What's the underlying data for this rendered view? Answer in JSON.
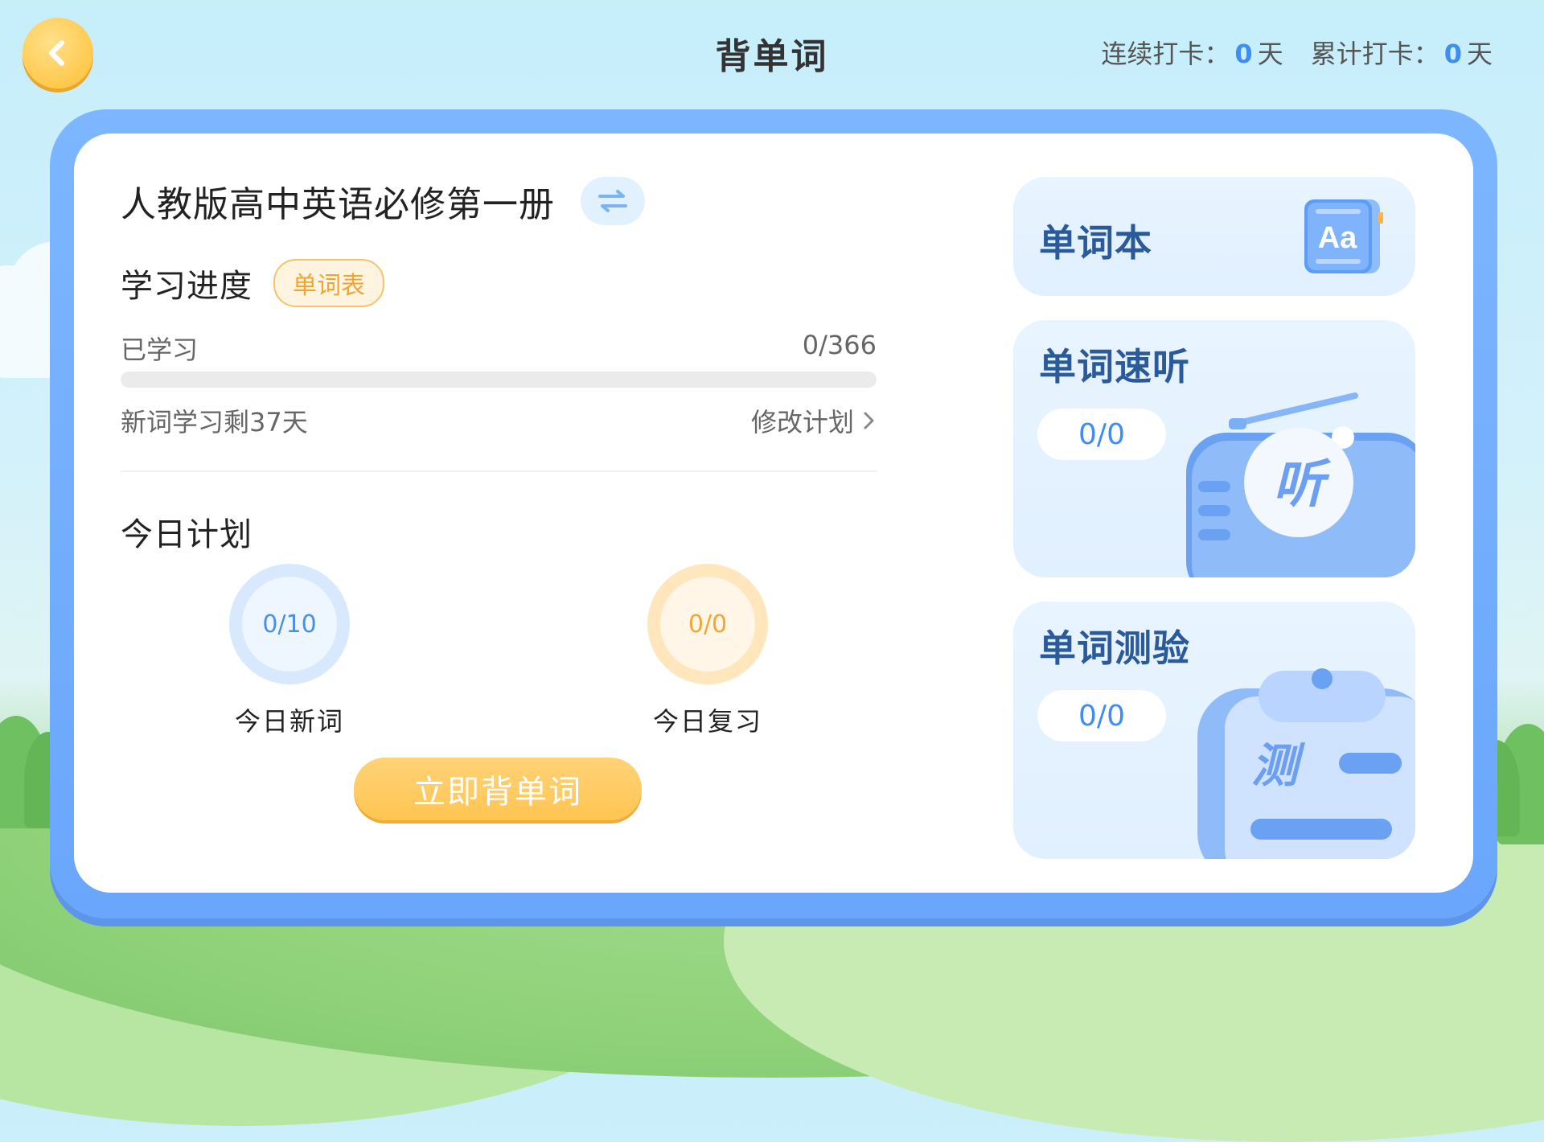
{
  "header": {
    "title": "背单词",
    "streak_label": "连续打卡：",
    "streak_value": "0",
    "total_label": "累计打卡：",
    "total_value": "0",
    "day_unit": "天"
  },
  "book": {
    "title": "人教版高中英语必修第一册"
  },
  "progress": {
    "section_title": "学习进度",
    "wordlist_label": "单词表",
    "learned_label": "已学习",
    "learned_count": "0/366",
    "learned_fraction": 0,
    "remaining_text": "新词学习剩37天",
    "modify_plan_label": "修改计划"
  },
  "today": {
    "section_title": "今日计划",
    "new_words": {
      "value": "0/10",
      "label": "今日新词"
    },
    "review": {
      "value": "0/0",
      "label": "今日复习"
    },
    "start_button": "立即背单词"
  },
  "cards": {
    "wordbook": {
      "title": "单词本",
      "icon_text": "Aa"
    },
    "listening": {
      "title": "单词速听",
      "count": "0/0",
      "icon_text": "听"
    },
    "quiz": {
      "title": "单词测验",
      "count": "0/0",
      "icon_text": "测"
    }
  },
  "colors": {
    "accent_blue": "#3d8df5",
    "accent_orange": "#ffc552",
    "frame_blue": "#7db6ff"
  }
}
